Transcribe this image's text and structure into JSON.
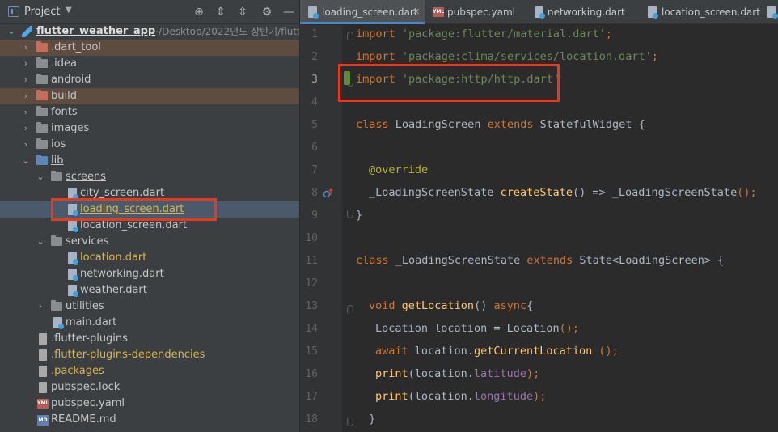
{
  "project_panel": {
    "title": "Project",
    "tree": [
      {
        "label": "flutter_weather_app",
        "path": "~/Desktop/2022년도 상반기/flutt",
        "type": "root"
      },
      {
        "label": ".dart_tool",
        "type": "folder"
      },
      {
        "label": ".idea",
        "type": "folder"
      },
      {
        "label": "android",
        "type": "folder"
      },
      {
        "label": "build",
        "type": "folder"
      },
      {
        "label": "fonts",
        "type": "folder"
      },
      {
        "label": "images",
        "type": "folder"
      },
      {
        "label": "ios",
        "type": "folder"
      },
      {
        "label": "lib",
        "type": "folder"
      },
      {
        "label": "screens",
        "type": "folder"
      },
      {
        "label": "city_screen.dart",
        "type": "file"
      },
      {
        "label": "loading_screen.dart",
        "type": "file"
      },
      {
        "label": "location_screen.dart",
        "type": "file"
      },
      {
        "label": "services",
        "type": "folder"
      },
      {
        "label": "location.dart",
        "type": "file"
      },
      {
        "label": "networking.dart",
        "type": "file"
      },
      {
        "label": "weather.dart",
        "type": "file"
      },
      {
        "label": "utilities",
        "type": "folder"
      },
      {
        "label": "main.dart",
        "type": "file"
      },
      {
        "label": ".flutter-plugins",
        "type": "file"
      },
      {
        "label": ".flutter-plugins-dependencies",
        "type": "file"
      },
      {
        "label": ".packages",
        "type": "file"
      },
      {
        "label": "pubspec.lock",
        "type": "file"
      },
      {
        "label": "pubspec.yaml",
        "type": "file"
      },
      {
        "label": "README.md",
        "type": "file"
      }
    ]
  },
  "tabs": [
    {
      "label": "loading_screen.dart",
      "active": true
    },
    {
      "label": "pubspec.yaml",
      "active": false
    },
    {
      "label": "networking.dart",
      "active": false
    },
    {
      "label": "location_screen.dart",
      "active": false
    }
  ],
  "editor": {
    "line_numbers": [
      "1",
      "2",
      "3",
      "4",
      "5",
      "6",
      "7",
      "8",
      "9",
      "10",
      "11",
      "12",
      "13",
      "14",
      "15",
      "16",
      "17",
      "18"
    ],
    "current_line": "3",
    "lines": {
      "l1": {
        "kw": "import",
        "str": "'package:flutter/material.dart'",
        "end": ";"
      },
      "l2": {
        "kw": "import",
        "str": "'package:clima/services/location.dart'",
        "end": ";"
      },
      "l3": {
        "kw": "import",
        "str": "'package:http/http.dart'",
        "end": ""
      },
      "l5": {
        "kw1": "class",
        "name": "LoadingScreen",
        "kw2": "extends",
        "parent": "StatefulWidget",
        "end": "{"
      },
      "l7": {
        "ann": "@override"
      },
      "l8": {
        "type": "_LoadingScreenState",
        "fn": "createState",
        "rest": "() => ",
        "ret": "_LoadingScreenState",
        "end": "();"
      },
      "l9": {
        "text": "}"
      },
      "l11": {
        "kw1": "class",
        "name": "_LoadingScreenState",
        "kw2": "extends",
        "parent": "State<LoadingScreen>",
        "end": "{"
      },
      "l13": {
        "kw": "void",
        "fn": "getLocation",
        "rest": "() ",
        "kw2": "async",
        "end": "{"
      },
      "l14": {
        "type": "Location",
        "var": "location",
        "op": " = ",
        "ctor": "Location",
        "end": "();"
      },
      "l15": {
        "kw": "await",
        "obj": "location.",
        "fn": "getCurrentLocation",
        "end": " ();"
      },
      "l16": {
        "fn": "print",
        "open": "(location.",
        "field": "latitude",
        "end": ");"
      },
      "l17": {
        "fn": "print",
        "open": "(location.",
        "field": "longitude",
        "end": ");"
      },
      "l18": {
        "text": "}"
      }
    }
  }
}
